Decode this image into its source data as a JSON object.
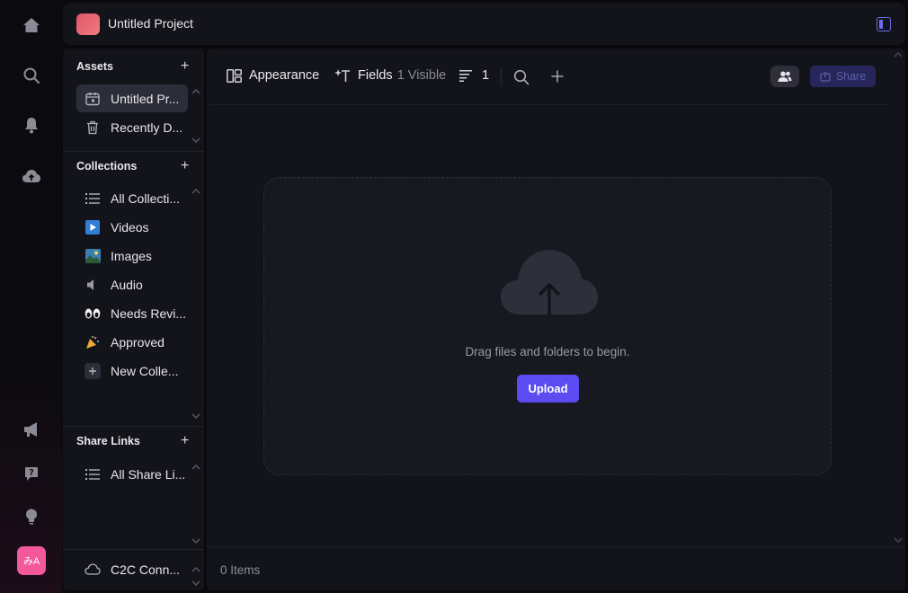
{
  "project": {
    "title": "Untitled Project"
  },
  "rail": {
    "items": [
      "home-icon",
      "search-icon",
      "bell-icon",
      "cloud-upload-icon"
    ],
    "bottom_items": [
      "megaphone-icon",
      "help-icon",
      "lightbulb-icon"
    ],
    "avatar_text": "みA"
  },
  "sidebar": {
    "assets": {
      "title": "Assets",
      "items": [
        {
          "label": "Untitled Pr...",
          "icon": "project-icon",
          "selected": true
        },
        {
          "label": "Recently D...",
          "icon": "trash-icon",
          "selected": false
        }
      ]
    },
    "collections": {
      "title": "Collections",
      "items": [
        {
          "label": "All Collecti...",
          "icon": "list-icon"
        },
        {
          "label": "Videos",
          "icon": "play-icon"
        },
        {
          "label": "Images",
          "icon": "image-icon"
        },
        {
          "label": "Audio",
          "icon": "speaker-icon"
        },
        {
          "label": "Needs Revi...",
          "icon": "eyes-icon"
        },
        {
          "label": "Approved",
          "icon": "party-icon"
        },
        {
          "label": "New Colle...",
          "icon": "plus-icon"
        }
      ]
    },
    "share_links": {
      "title": "Share Links",
      "items": [
        {
          "label": "All Share Li...",
          "icon": "list-icon"
        }
      ]
    },
    "footer": {
      "label": "C2C Conn...",
      "icon": "cloud-icon"
    }
  },
  "toolbar": {
    "appearance_label": "Appearance",
    "fields_label": "Fields",
    "fields_visible": "1 Visible",
    "sort_count": "1",
    "share_label": "Share"
  },
  "dropzone": {
    "text": "Drag files and folders to begin.",
    "upload_label": "Upload"
  },
  "footer": {
    "items_count": "0 Items"
  },
  "colors": {
    "accent": "#5b4bf0",
    "avatar": "#f2589a",
    "background": "#13131a"
  }
}
